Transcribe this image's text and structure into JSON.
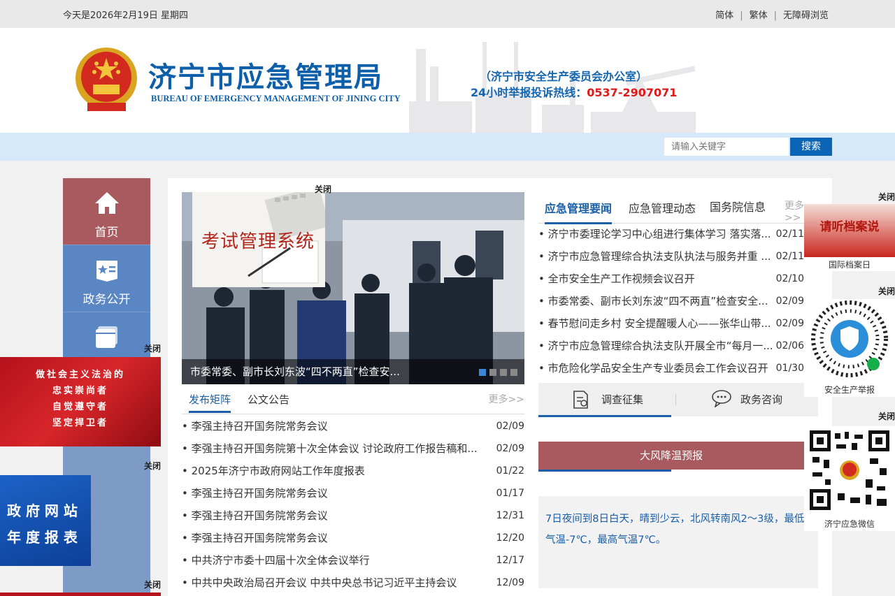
{
  "topbar": {
    "date": "今天是2026年2月19日 星期四",
    "simplified": "简体",
    "traditional": "繁体",
    "accessible": "无障碍浏览",
    "sep": "|"
  },
  "header": {
    "title": "济宁市应急管理局",
    "subtitle": "BUREAU OF EMERGENCY MANAGEMENT OF JINING CITY",
    "office": "（济宁市安全生产委员会办公室）",
    "hotline_label": "24小时举报投诉热线：",
    "hotline_number": "0537-2907071"
  },
  "search": {
    "placeholder": "请输入关键字",
    "button": "搜索"
  },
  "nav": [
    {
      "label": "首页",
      "icon": "home-icon"
    },
    {
      "label": "政务公开",
      "icon": "book-icon"
    },
    {
      "label": "",
      "icon": "window-icon"
    }
  ],
  "close_label": "关闭",
  "slider": {
    "caption": "市委常委、副市长刘东波“四不两直”检查安...",
    "exam_text": "考试管理系统"
  },
  "left_panel": {
    "tabs": [
      "发布矩阵",
      "公文公告"
    ],
    "more": "更多>>",
    "items": [
      {
        "title": "李强主持召开国务院常务会议",
        "date": "02/09"
      },
      {
        "title": "李强主持召开国务院第十次全体会议 讨论政府工作报告稿和...",
        "date": "02/09"
      },
      {
        "title": "2025年济宁市政府网站工作年度报表",
        "date": "01/22"
      },
      {
        "title": "李强主持召开国务院常务会议",
        "date": "01/17"
      },
      {
        "title": "李强主持召开国务院常务会议",
        "date": "12/31"
      },
      {
        "title": "李强主持召开国务院常务会议",
        "date": "12/20"
      },
      {
        "title": "中共济宁市委十四届十次全体会议举行",
        "date": "12/17"
      },
      {
        "title": "中共中央政治局召开会议 中共中央总书记习近平主持会议",
        "date": "12/09"
      }
    ]
  },
  "right_panel": {
    "tabs": [
      "应急管理要闻",
      "应急管理动态",
      "国务院信息"
    ],
    "more": "更多>>",
    "items": [
      {
        "title": "济宁市委理论学习中心组进行集体学习 落实落...",
        "date": "02/11"
      },
      {
        "title": "济宁市应急管理综合执法支队执法与服务并重 ...",
        "date": "02/11"
      },
      {
        "title": "全市安全生产工作视频会议召开",
        "date": "02/10"
      },
      {
        "title": "市委常委、副市长刘东波“四不两直”检查安全...",
        "date": "02/09"
      },
      {
        "title": "春节慰问走乡村 安全提醒暖人心——张华山带...",
        "date": "02/09"
      },
      {
        "title": "济宁市应急管理综合执法支队开展全市“每月一...",
        "date": "02/06"
      },
      {
        "title": "市危险化学品安全生产专业委员会工作会议召开",
        "date": "01/30"
      }
    ]
  },
  "services": {
    "survey": "调查征集",
    "consult": "政务咨询"
  },
  "warning": {
    "title": "大风降温预报",
    "text": "7日夜间到8日白天，晴到少云，北风转南风2～3级，最低气温-7℃，最高气温7℃。"
  },
  "float_ads": {
    "law_lines": [
      "做社会主义法治的",
      "忠实崇尚者",
      "自觉遵守者",
      "坚定捍卫者"
    ],
    "report_lines": [
      "政 府 网 站",
      "年 度 报 表"
    ]
  },
  "side": {
    "archive_caption": "国际档案日",
    "archive_title": "请听档案说",
    "report_caption": "安全生产举报",
    "wechat_caption": "济宁应急微信"
  },
  "colors": {
    "brand_blue": "#0c5fa8",
    "hotline_red": "#e0191b",
    "nav_active": "#a85a5f",
    "nav_bg": "#7d9bc6"
  }
}
